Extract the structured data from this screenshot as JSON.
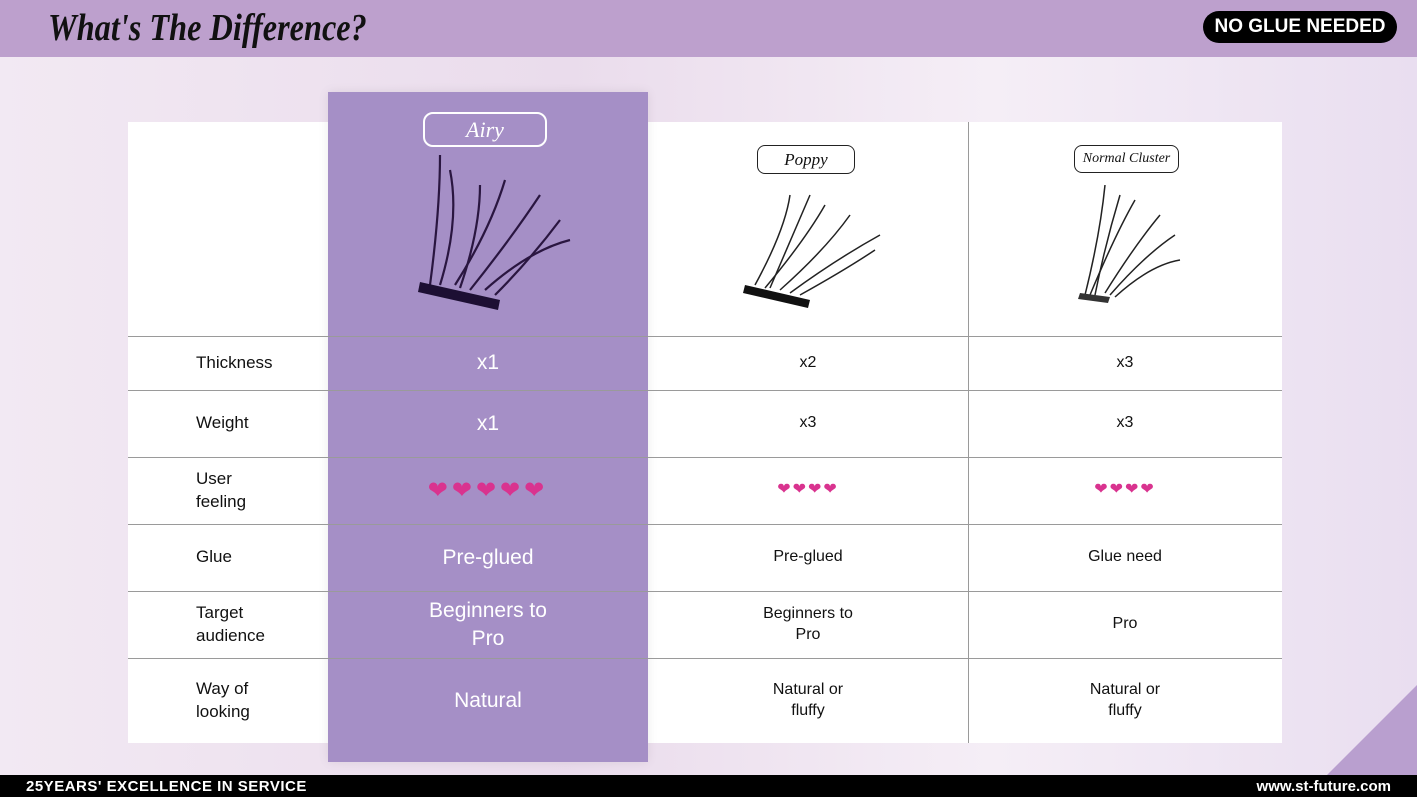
{
  "header": {
    "title": "What's The Difference?",
    "badge": "NO GLUE NEEDED"
  },
  "columns": [
    {
      "name": "Airy",
      "highlight": true
    },
    {
      "name": "Poppy"
    },
    {
      "name": "Normal Cluster"
    }
  ],
  "rows": [
    {
      "label": "Thickness",
      "values": [
        "x1",
        "x2",
        "x3"
      ]
    },
    {
      "label": "Weight",
      "values": [
        "x1",
        "x3",
        "x3"
      ]
    },
    {
      "label": "User feeling",
      "values": [
        "❤❤❤❤❤",
        "❤❤❤❤",
        "❤❤❤❤"
      ],
      "ratings": [
        5,
        4,
        4
      ]
    },
    {
      "label": "Glue",
      "values": [
        "Pre-glued",
        "Pre-glued",
        "Glue need"
      ]
    },
    {
      "label": "Target audience",
      "values": [
        "Beginners to Pro",
        "Beginners to Pro",
        "Pro"
      ]
    },
    {
      "label": "Way of looking",
      "values": [
        "Natural",
        "Natural or fluffy",
        "Natural or fluffy"
      ]
    }
  ],
  "colors": {
    "accent": "#a58fc6",
    "header": "#bda0cd",
    "heart": "#d9338f"
  },
  "footer": {
    "left": "25YEARS' EXCELLENCE IN SERVICE",
    "right": "www.st-future.com"
  }
}
